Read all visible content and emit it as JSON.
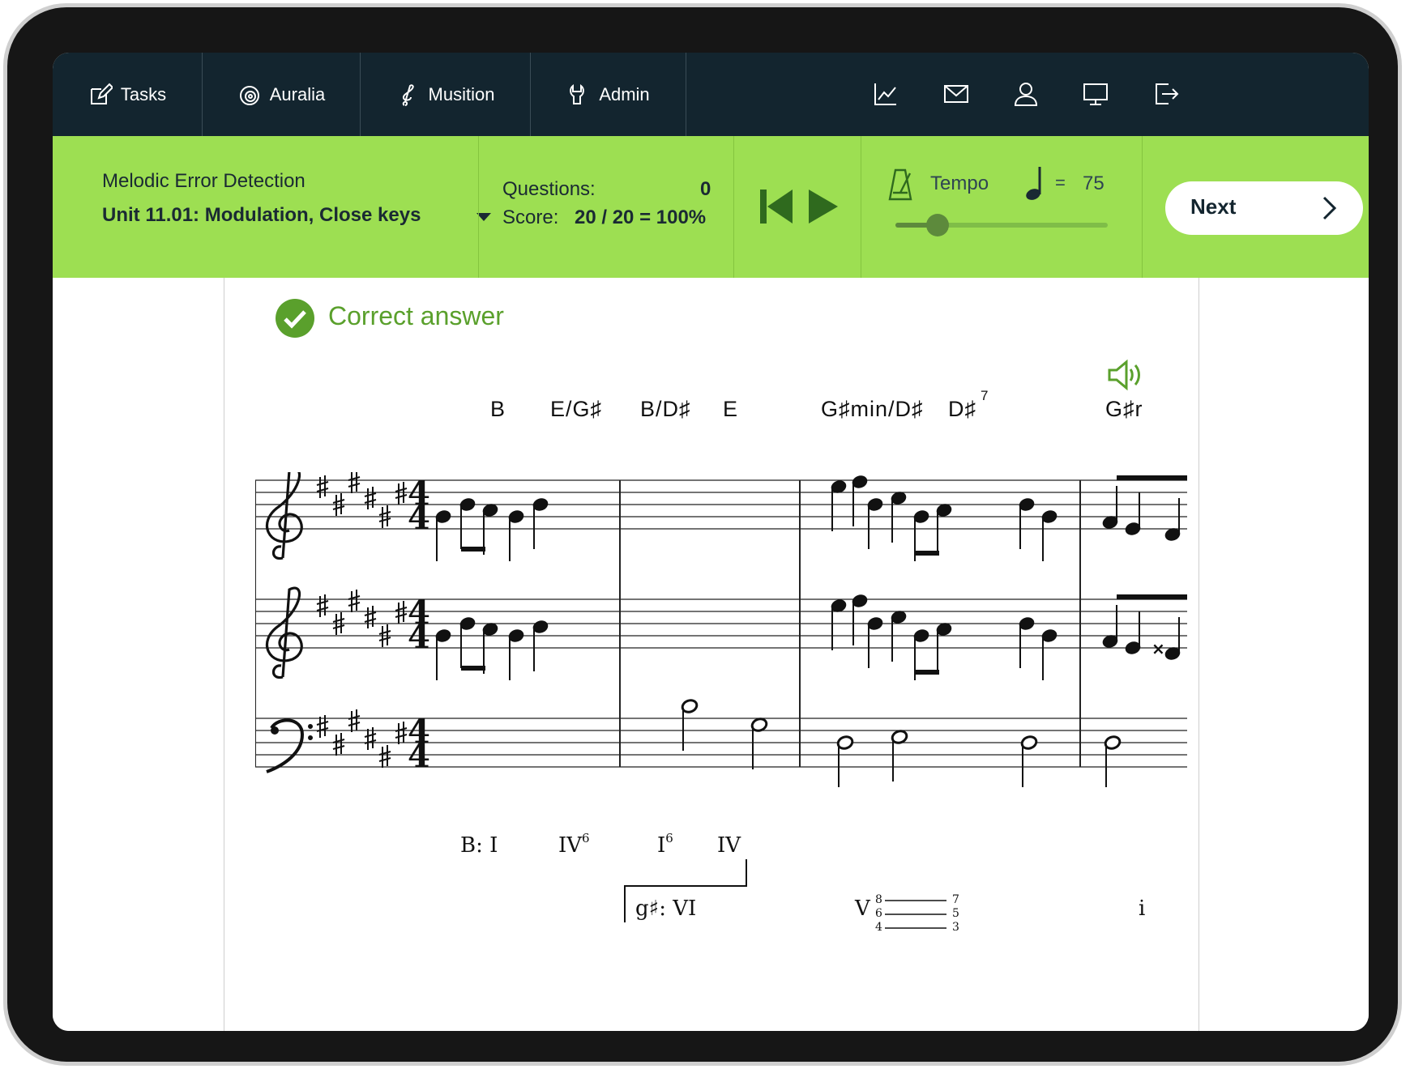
{
  "nav": {
    "tabs": [
      {
        "label": "Tasks",
        "icon": "edit-icon"
      },
      {
        "label": "Auralia",
        "icon": "ear-icon"
      },
      {
        "label": "Musition",
        "icon": "clef-icon"
      },
      {
        "label": "Admin",
        "icon": "admin-icon"
      }
    ],
    "right_icons": [
      "chart-icon",
      "mail-icon",
      "user-icon",
      "monitor-icon",
      "logout-icon"
    ]
  },
  "toolbar": {
    "exercise_title": "Melodic Error Detection",
    "unit": "Unit 11.01: Modulation, Close keys",
    "questions_label": "Questions:",
    "questions_value": "0",
    "score_label": "Score:",
    "score_value": "20 / 20 = 100%",
    "tempo_label": "Tempo",
    "tempo_equals": "=",
    "tempo_value": "75",
    "tempo_fraction": 0.2,
    "next_label": "Next"
  },
  "result": {
    "message": "Correct answer"
  },
  "chords": [
    "B",
    "E/G♯",
    "B/D♯",
    "E",
    "G♯min/D♯",
    "D♯",
    "7",
    "G♯r"
  ],
  "roman_numerals": {
    "key1": "B: I",
    "iv6": "IV",
    "iv6_fig": "6",
    "i6": "I",
    "i6_fig": "6",
    "iv": "IV",
    "key2": "g♯: VI",
    "v": "V",
    "v_fig_top": "8",
    "v_fig_mid": "6",
    "v_fig_bot": "4",
    "v_res_top": "7",
    "v_res_mid": "5",
    "v_res_bot": "3",
    "last": "i"
  },
  "colors": {
    "nav_bg": "#13252f",
    "toolbar_bg": "#9ddf52",
    "success_green": "#5aa02c",
    "text_dark": "#1a2a33"
  }
}
